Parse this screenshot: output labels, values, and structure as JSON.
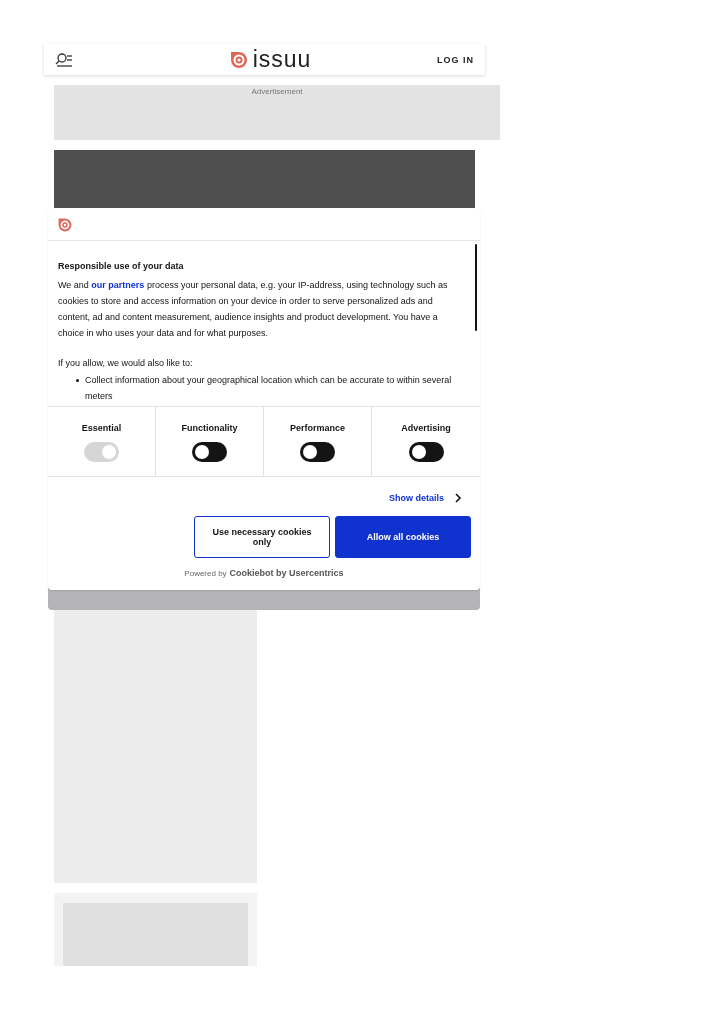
{
  "header": {
    "logo": "issuu",
    "login": "LOG IN"
  },
  "advertisement": {
    "label": "Advertisement"
  },
  "consent": {
    "title": "Responsible use of your data",
    "link": "our partners",
    "intro_before": "We and ",
    "intro_after": " process your personal data, e.g. your IP-address, using technology such as cookies to store and access information on your device in order to serve personalized ads and content, ad and content measurement, audience insights and product development. You have a choice in who uses your data and for what purposes.",
    "allow_lead": "If you allow, we would also like to:",
    "bullets": [
      "Collect information about your geographical location which can be accurate to within several meters"
    ],
    "categories": [
      {
        "label": "Essential",
        "on": true,
        "disabled": true
      },
      {
        "label": "Functionality",
        "on": false,
        "disabled": false
      },
      {
        "label": "Performance",
        "on": false,
        "disabled": false
      },
      {
        "label": "Advertising",
        "on": false,
        "disabled": false
      }
    ],
    "show_details": "Show details",
    "buttons": [
      {
        "label": "Use necessary cookies only",
        "kind": "outline"
      },
      {
        "label": "Allow all cookies",
        "kind": "primary"
      }
    ],
    "powered_by": "Powered by",
    "provider": "Cookiebot by Usercentrics"
  }
}
